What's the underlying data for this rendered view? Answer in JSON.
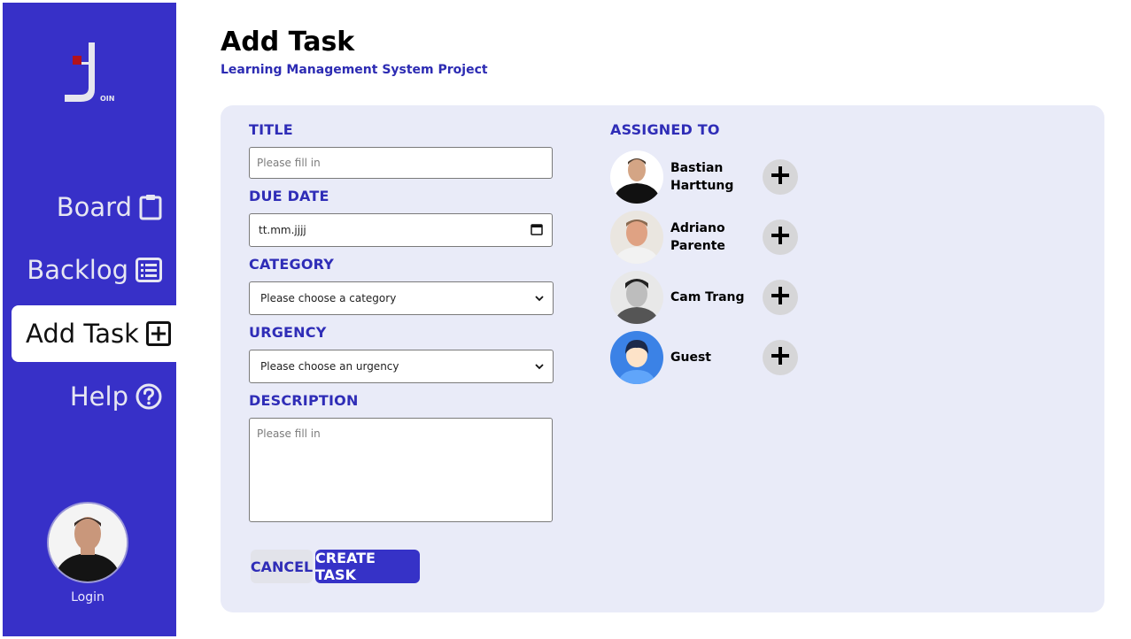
{
  "brand": {
    "logo_text": "OIN"
  },
  "nav": {
    "items": [
      {
        "label": "Board",
        "icon": "clipboard-icon"
      },
      {
        "label": "Backlog",
        "icon": "list-icon"
      },
      {
        "label": "Add Task",
        "icon": "plus-square-icon",
        "active": true
      },
      {
        "label": "Help",
        "icon": "help-circle-icon"
      }
    ],
    "login_label": "Login"
  },
  "header": {
    "title": "Add Task",
    "subtitle": "Learning Management System Project"
  },
  "form": {
    "title_label": "TITLE",
    "title_placeholder": "Please fill in",
    "due_date_label": "DUE DATE",
    "due_date_value": "tt.mm.jjjj",
    "category_label": "CATEGORY",
    "category_value": "Please choose a category",
    "urgency_label": "URGENCY",
    "urgency_value": "Please choose an urgency",
    "description_label": "DESCRIPTION",
    "description_placeholder": "Please fill in",
    "cancel_label": "CANCEL",
    "create_label": "CREATE TASK"
  },
  "assigned": {
    "label": "ASSIGNED TO",
    "members": [
      {
        "name": "Bastian Harttung"
      },
      {
        "name": "Adriano Parente"
      },
      {
        "name": "Cam Trang"
      },
      {
        "name": "Guest"
      }
    ]
  },
  "colors": {
    "sidebar": "#3730c8",
    "accent": "#2f2db7",
    "card_bg": "#e9ebf8",
    "logo_red": "#b3121b"
  }
}
